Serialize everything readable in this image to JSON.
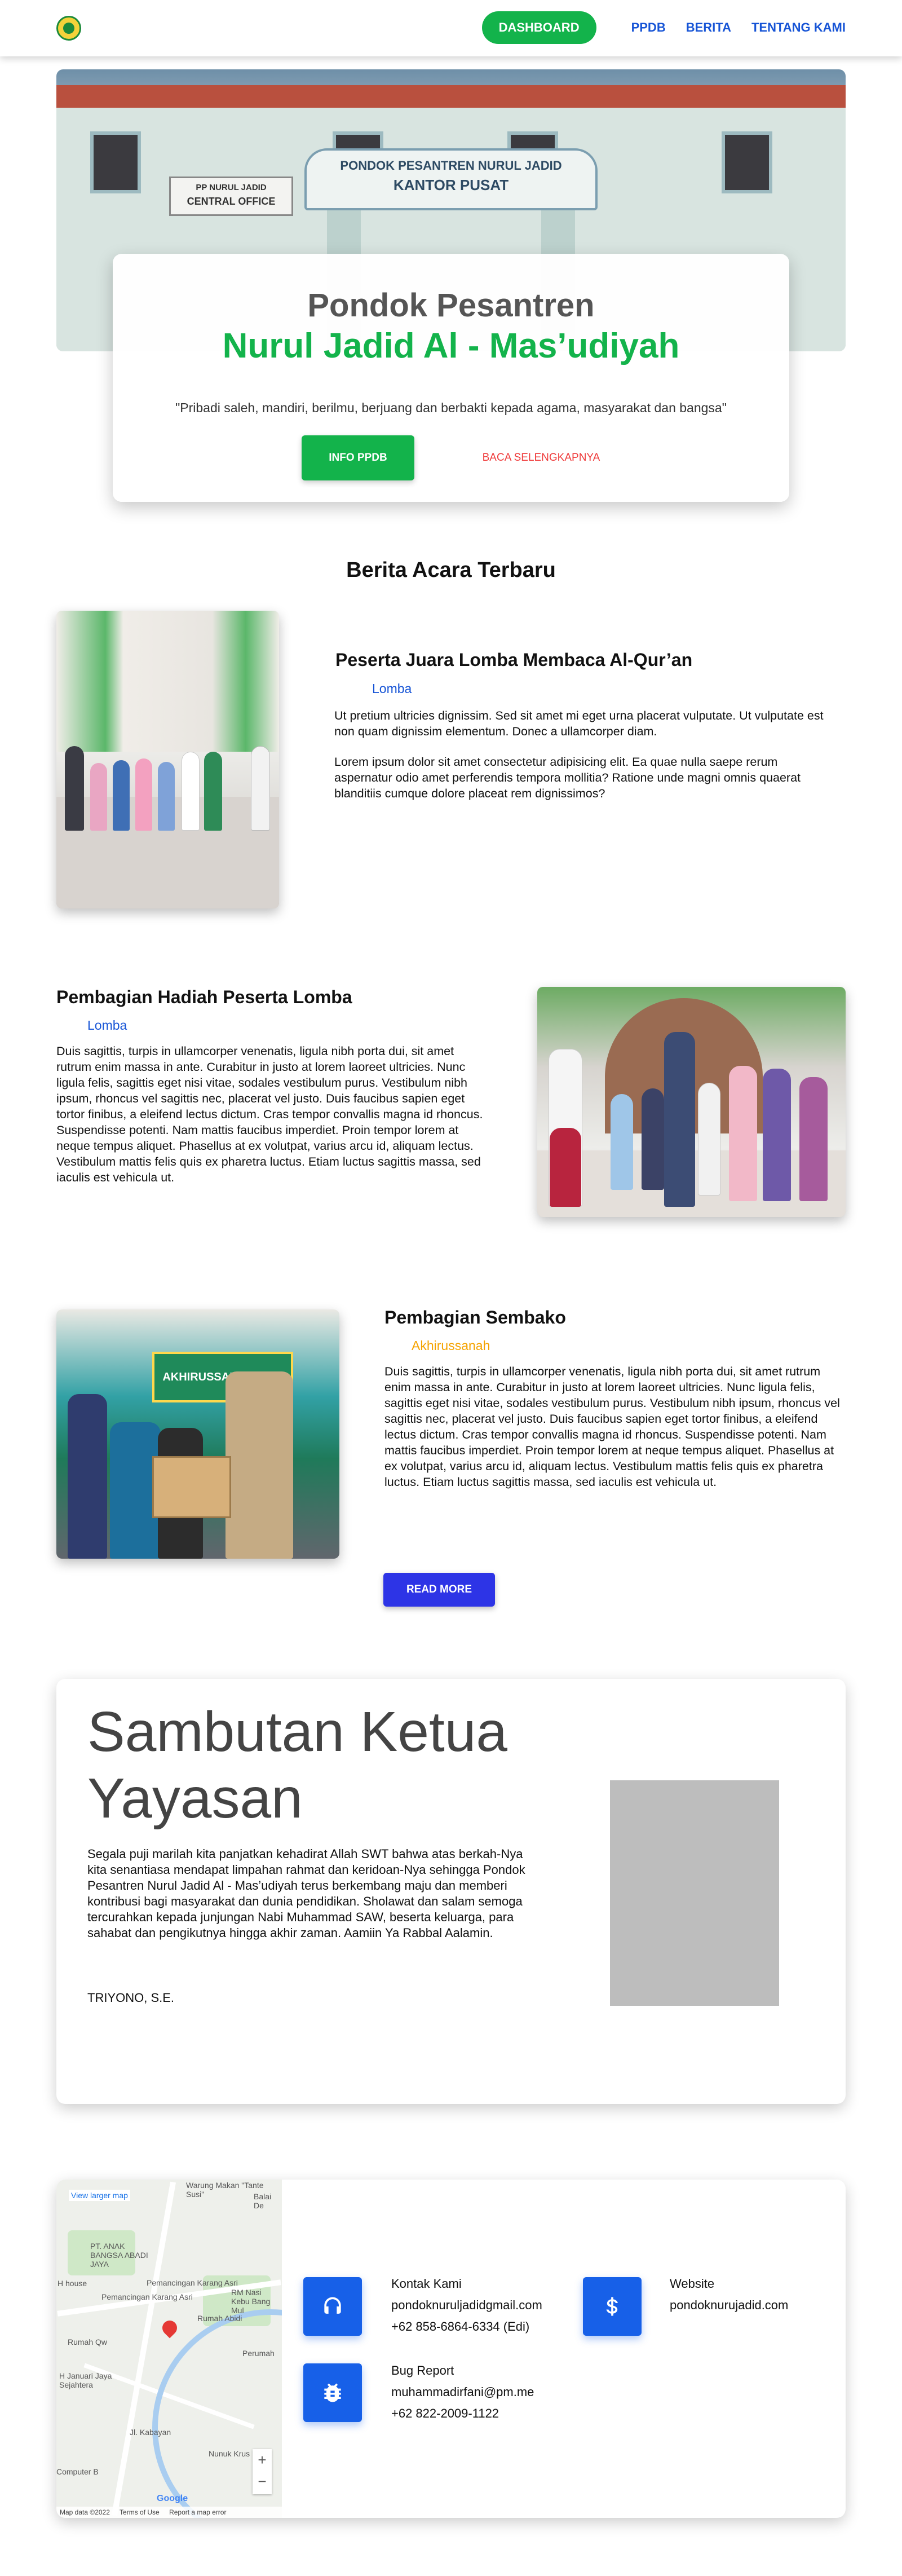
{
  "nav": {
    "logo_icon": "school-crest-icon",
    "dashboard": "DASHBOARD",
    "ppdb": "PPDB",
    "berita": "BERITA",
    "tentang": "TENTANG KAMI"
  },
  "hero": {
    "title_line1": "Pondok Pesantren",
    "title_line2": "Nurul Jadid Al - Mas’udiyah",
    "motto": "\"Pribadi saleh, mandiri, berilmu, berjuang dan berbakti kepada agama, masyarakat dan bangsa\"",
    "btn_info": "INFO PPDB",
    "btn_more": "BACA SELENGKAPNYA",
    "sign_text": "PONDOK PESANTREN NURUL JADID",
    "sign_sub": "KANTOR PUSAT",
    "sign_left1": "PP NURUL JADID",
    "sign_left2": "CENTRAL OFFICE"
  },
  "news": {
    "section_title": "Berita Acara Terbaru",
    "items": [
      {
        "title": "Peserta Juara Lomba Membaca Al-Qur’an",
        "category": "Lomba",
        "p1": "Ut pretium ultricies dignissim. Sed sit amet mi eget urna placerat vulputate. Ut vulputate est non quam dignissim elementum. Donec a ullamcorper diam.",
        "p2": "Lorem ipsum dolor sit amet consectetur adipisicing elit. Ea quae nulla saepe rerum aspernatur odio amet perferendis tempora mollitia? Ratione unde magni omnis quaerat blanditiis cumque dolore placeat rem dignissimos?"
      },
      {
        "title": "Pembagian Hadiah Peserta Lomba",
        "category": "Lomba",
        "p1": "Duis sagittis, turpis in ullamcorper venenatis, ligula nibh porta dui, sit amet rutrum enim massa in ante. Curabitur in justo at lorem laoreet ultricies. Nunc ligula felis, sagittis eget nisi vitae, sodales vestibulum purus. Vestibulum nibh ipsum, rhoncus vel sagittis nec, placerat vel justo. Duis faucibus sapien eget tortor finibus, a eleifend lectus dictum. Cras tempor convallis magna id rhoncus. Suspendisse potenti. Nam mattis faucibus imperdiet. Proin tempor lorem at neque tempus aliquet. Phasellus at ex volutpat, varius arcu id, aliquam lectus. Vestibulum mattis felis quis ex pharetra luctus. Etiam luctus sagittis massa, sed iaculis est vehicula ut."
      },
      {
        "title": "Pembagian Sembako",
        "category": "Akhirussanah",
        "p1": "Duis sagittis, turpis in ullamcorper venenatis, ligula nibh porta dui, sit amet rutrum enim massa in ante. Curabitur in justo at lorem laoreet ultricies. Nunc ligula felis, sagittis eget nisi vitae, sodales vestibulum purus. Vestibulum nibh ipsum, rhoncus vel sagittis nec, placerat vel justo. Duis faucibus sapien eget tortor finibus, a eleifend lectus dictum. Cras tempor convallis magna id rhoncus. Suspendisse potenti. Nam mattis faucibus imperdiet. Proin tempor lorem at neque tempus aliquet. Phasellus at ex volutpat, varius arcu id, aliquam lectus. Vestibulum mattis felis quis ex pharetra luctus. Etiam luctus sagittis massa, sed iaculis est vehicula ut."
      }
    ],
    "banner_text": "AKHIRUSSANAH KE-2",
    "read_more": "READ MORE"
  },
  "sambutan": {
    "title": "Sambutan Ketua Yayasan",
    "text": "Segala puji marilah kita panjatkan kehadirat Allah SWT bahwa atas berkah-Nya\nkita senantiasa mendapat limpahan rahmat dan keridoan-Nya sehingga Pondok Pesantren Nurul Jadid Al - Mas’udiyah terus berkembang maju dan memberi kontribusi bagi masyarakat dan dunia pendidikan. Sholawat dan salam semoga tercurahkan kepada junjungan Nabi Muhammad SAW, beserta keluarga, para sahabat dan pengikutnya hingga akhir zaman. Aamiin Ya Rabbal Aalamin.",
    "signature": "TRIYONO, S.E."
  },
  "contact": {
    "map": {
      "view_larger": "View larger map",
      "labels": [
        "Warung Makan \"Tante Susi\"",
        "Balai De",
        "PT. ANAK BANGSA ABADI JAYA",
        "Pemancingan Karang Asri",
        "Pemancingan Karang Asri",
        "RM Nasi Kebu Bang Mul",
        "Rumah Abidi",
        "Rumah Qw",
        "Perumah",
        "H Januari Jaya Sejahtera",
        "Nunuk Krus",
        "Computer B",
        "Jl. Kabayan",
        "H house"
      ],
      "footer_data": "Map data ©2022",
      "footer_terms": "Terms of Use",
      "footer_report": "Report a map error",
      "google": "Google"
    },
    "kontak_title": "Kontak Kami",
    "kontak_email": "pondoknuruljadidgmail.com",
    "kontak_phone": "+62 858-6864-6334 (Edi)",
    "website_title": "Website",
    "website_url": "pondoknurujadid.com",
    "bug_title": "Bug Report",
    "bug_email": "muhammadirfani@pm.me",
    "bug_phone": "+62 822-2009-1122",
    "icons": [
      "headset-icon",
      "dollar-icon",
      "bug-icon"
    ],
    "accent": "#1760e8"
  },
  "colors": {
    "brand_green": "#13b34b",
    "link_blue": "#1654d6",
    "cta_red": "#ef3b3b",
    "button_blue": "#2d34e6",
    "category_blue": "#1654d6",
    "category_orange": "#f5a300"
  }
}
